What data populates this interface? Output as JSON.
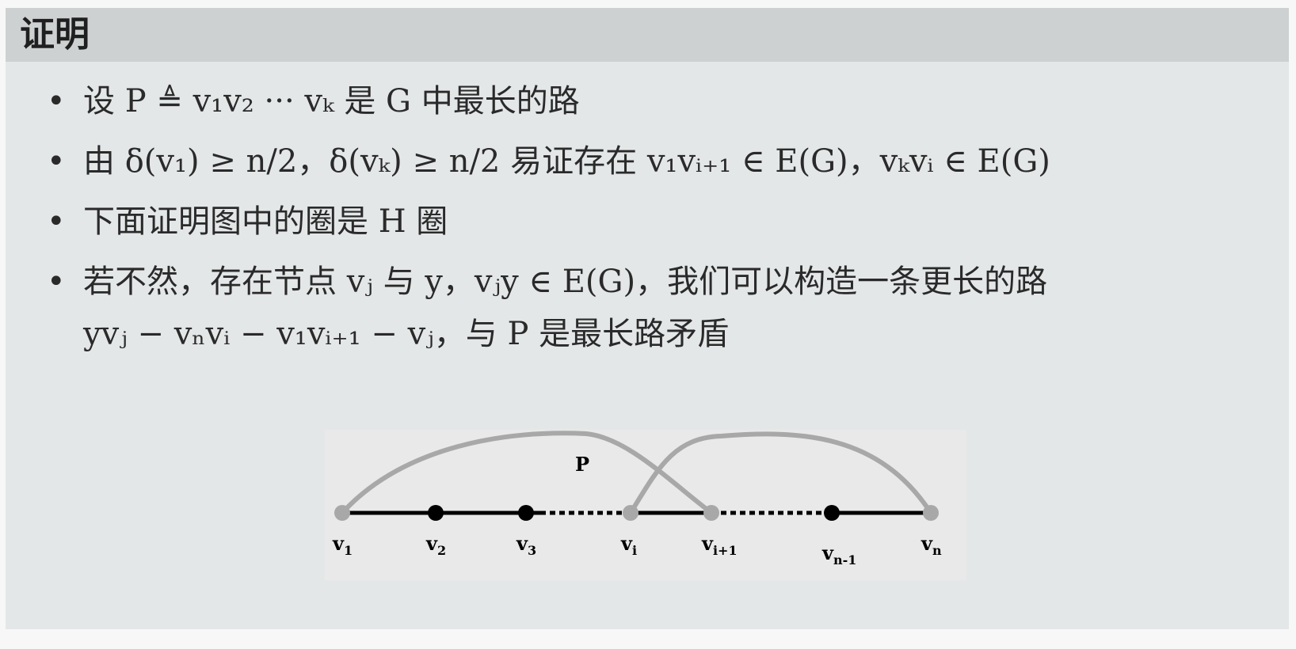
{
  "header": {
    "title": "证明"
  },
  "bullets": [
    {
      "text": "设 P ≜ v₁v₂ ··· vₖ 是 G 中最长的路"
    },
    {
      "text": "由 δ(v₁) ≥ n/2，δ(vₖ) ≥ n/2 易证存在 v₁vᵢ₊₁ ∈ E(G)，vₖvᵢ ∈ E(G)"
    },
    {
      "text": "下面证明图中的圈是 H 圈"
    },
    {
      "text": "若不然，存在节点 vⱼ 与 y，vⱼy ∈ E(G)，我们可以构造一条更长的路",
      "continuation": "yvⱼ − vₙvᵢ − v₁vᵢ₊₁ − vⱼ，与 P 是最长路矛盾"
    }
  ],
  "diagram": {
    "path_label": "P",
    "nodes": [
      {
        "label": "v",
        "sub": "1",
        "color": "#a8a8a8"
      },
      {
        "label": "v",
        "sub": "2",
        "color": "#000000"
      },
      {
        "label": "v",
        "sub": "3",
        "color": "#000000"
      },
      {
        "label": "v",
        "sub": "i",
        "color": "#a8a8a8"
      },
      {
        "label": "v",
        "sub": "i+1",
        "color": "#a8a8a8"
      },
      {
        "label": "v",
        "sub": "n-1",
        "color": "#000000"
      },
      {
        "label": "v",
        "sub": "n",
        "color": "#a8a8a8"
      }
    ]
  },
  "colors": {
    "slide_bg": "#e4e7e8",
    "header_bg": "#ced1d2",
    "curve": "#a8a8a8",
    "edge": "#000000"
  }
}
